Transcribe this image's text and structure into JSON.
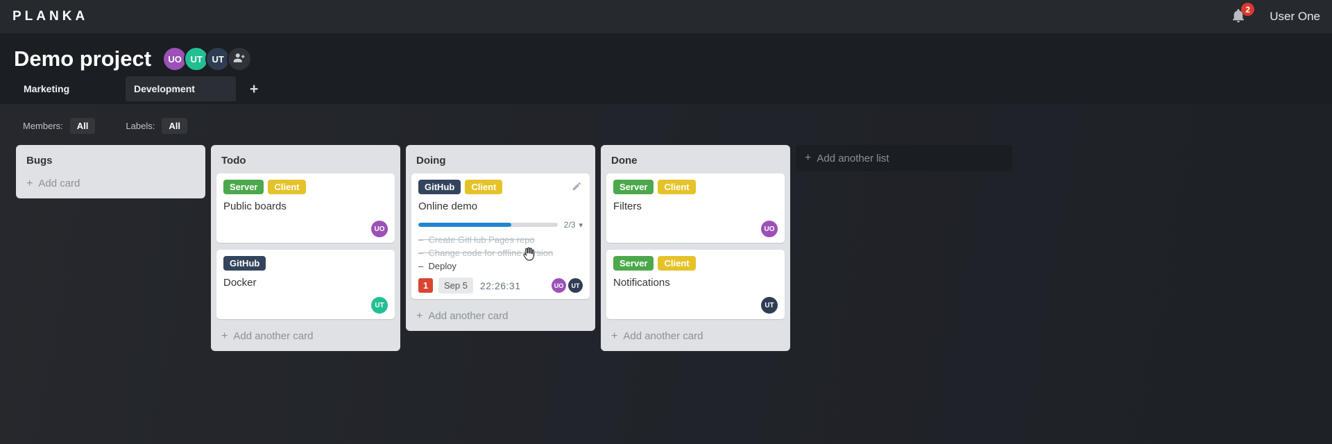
{
  "topbar": {
    "logo": "PLANKA",
    "notifications_count": "2",
    "user_name": "User One"
  },
  "project": {
    "title": "Demo project",
    "members": [
      {
        "initials": "UO",
        "color": "#9b51b5"
      },
      {
        "initials": "UT",
        "color": "#23bf94"
      },
      {
        "initials": "UT",
        "color": "#2e3d52"
      }
    ]
  },
  "tabs": {
    "items": [
      {
        "label": "Marketing",
        "active": false
      },
      {
        "label": "Development",
        "active": true
      }
    ],
    "add_label": "+"
  },
  "filters": {
    "members_label": "Members:",
    "members_value": "All",
    "labels_label": "Labels:",
    "labels_value": "All"
  },
  "board": {
    "add_list_label": "Add another list",
    "lists": [
      {
        "name": "Bugs",
        "add_label": "Add card",
        "cards": []
      },
      {
        "name": "Todo",
        "add_label": "Add another card",
        "cards": [
          {
            "title": "Public boards",
            "labels": [
              {
                "name": "Server",
                "color": "#4ba84b"
              },
              {
                "name": "Client",
                "color": "#e6c229"
              }
            ],
            "members": [
              {
                "initials": "UO",
                "color": "#9b51b5"
              }
            ]
          },
          {
            "title": "Docker",
            "labels": [
              {
                "name": "GitHub",
                "color": "#33455c"
              }
            ],
            "members": [
              {
                "initials": "UT",
                "color": "#23bf94"
              }
            ]
          }
        ]
      },
      {
        "name": "Doing",
        "add_label": "Add another card",
        "cards": [
          {
            "title": "Online demo",
            "labels": [
              {
                "name": "GitHub",
                "color": "#33455c"
              },
              {
                "name": "Client",
                "color": "#e6c229"
              }
            ],
            "progress": {
              "label": "2/3",
              "percent": "66.7%",
              "color": "#2185d0",
              "caret": "▾"
            },
            "tasks": [
              {
                "text": "Create GitHub Pages repo",
                "done": true
              },
              {
                "text": "Change code for offline version",
                "done": true
              },
              {
                "text": "Deploy",
                "done": false
              }
            ],
            "notifications_count": "1",
            "due_date": "Sep 5",
            "timer": "22:26:31",
            "members": [
              {
                "initials": "UO",
                "color": "#9b51b5"
              },
              {
                "initials": "UT",
                "color": "#2e3d52"
              }
            ]
          }
        ]
      },
      {
        "name": "Done",
        "add_label": "Add another card",
        "cards": [
          {
            "title": "Filters",
            "labels": [
              {
                "name": "Server",
                "color": "#4ba84b"
              },
              {
                "name": "Client",
                "color": "#e6c229"
              }
            ],
            "members": [
              {
                "initials": "UO",
                "color": "#9b51b5"
              }
            ]
          },
          {
            "title": "Notifications",
            "labels": [
              {
                "name": "Server",
                "color": "#4ba84b"
              },
              {
                "name": "Client",
                "color": "#e6c229"
              }
            ],
            "members": [
              {
                "initials": "UT",
                "color": "#2e3d52"
              }
            ]
          }
        ]
      }
    ]
  }
}
